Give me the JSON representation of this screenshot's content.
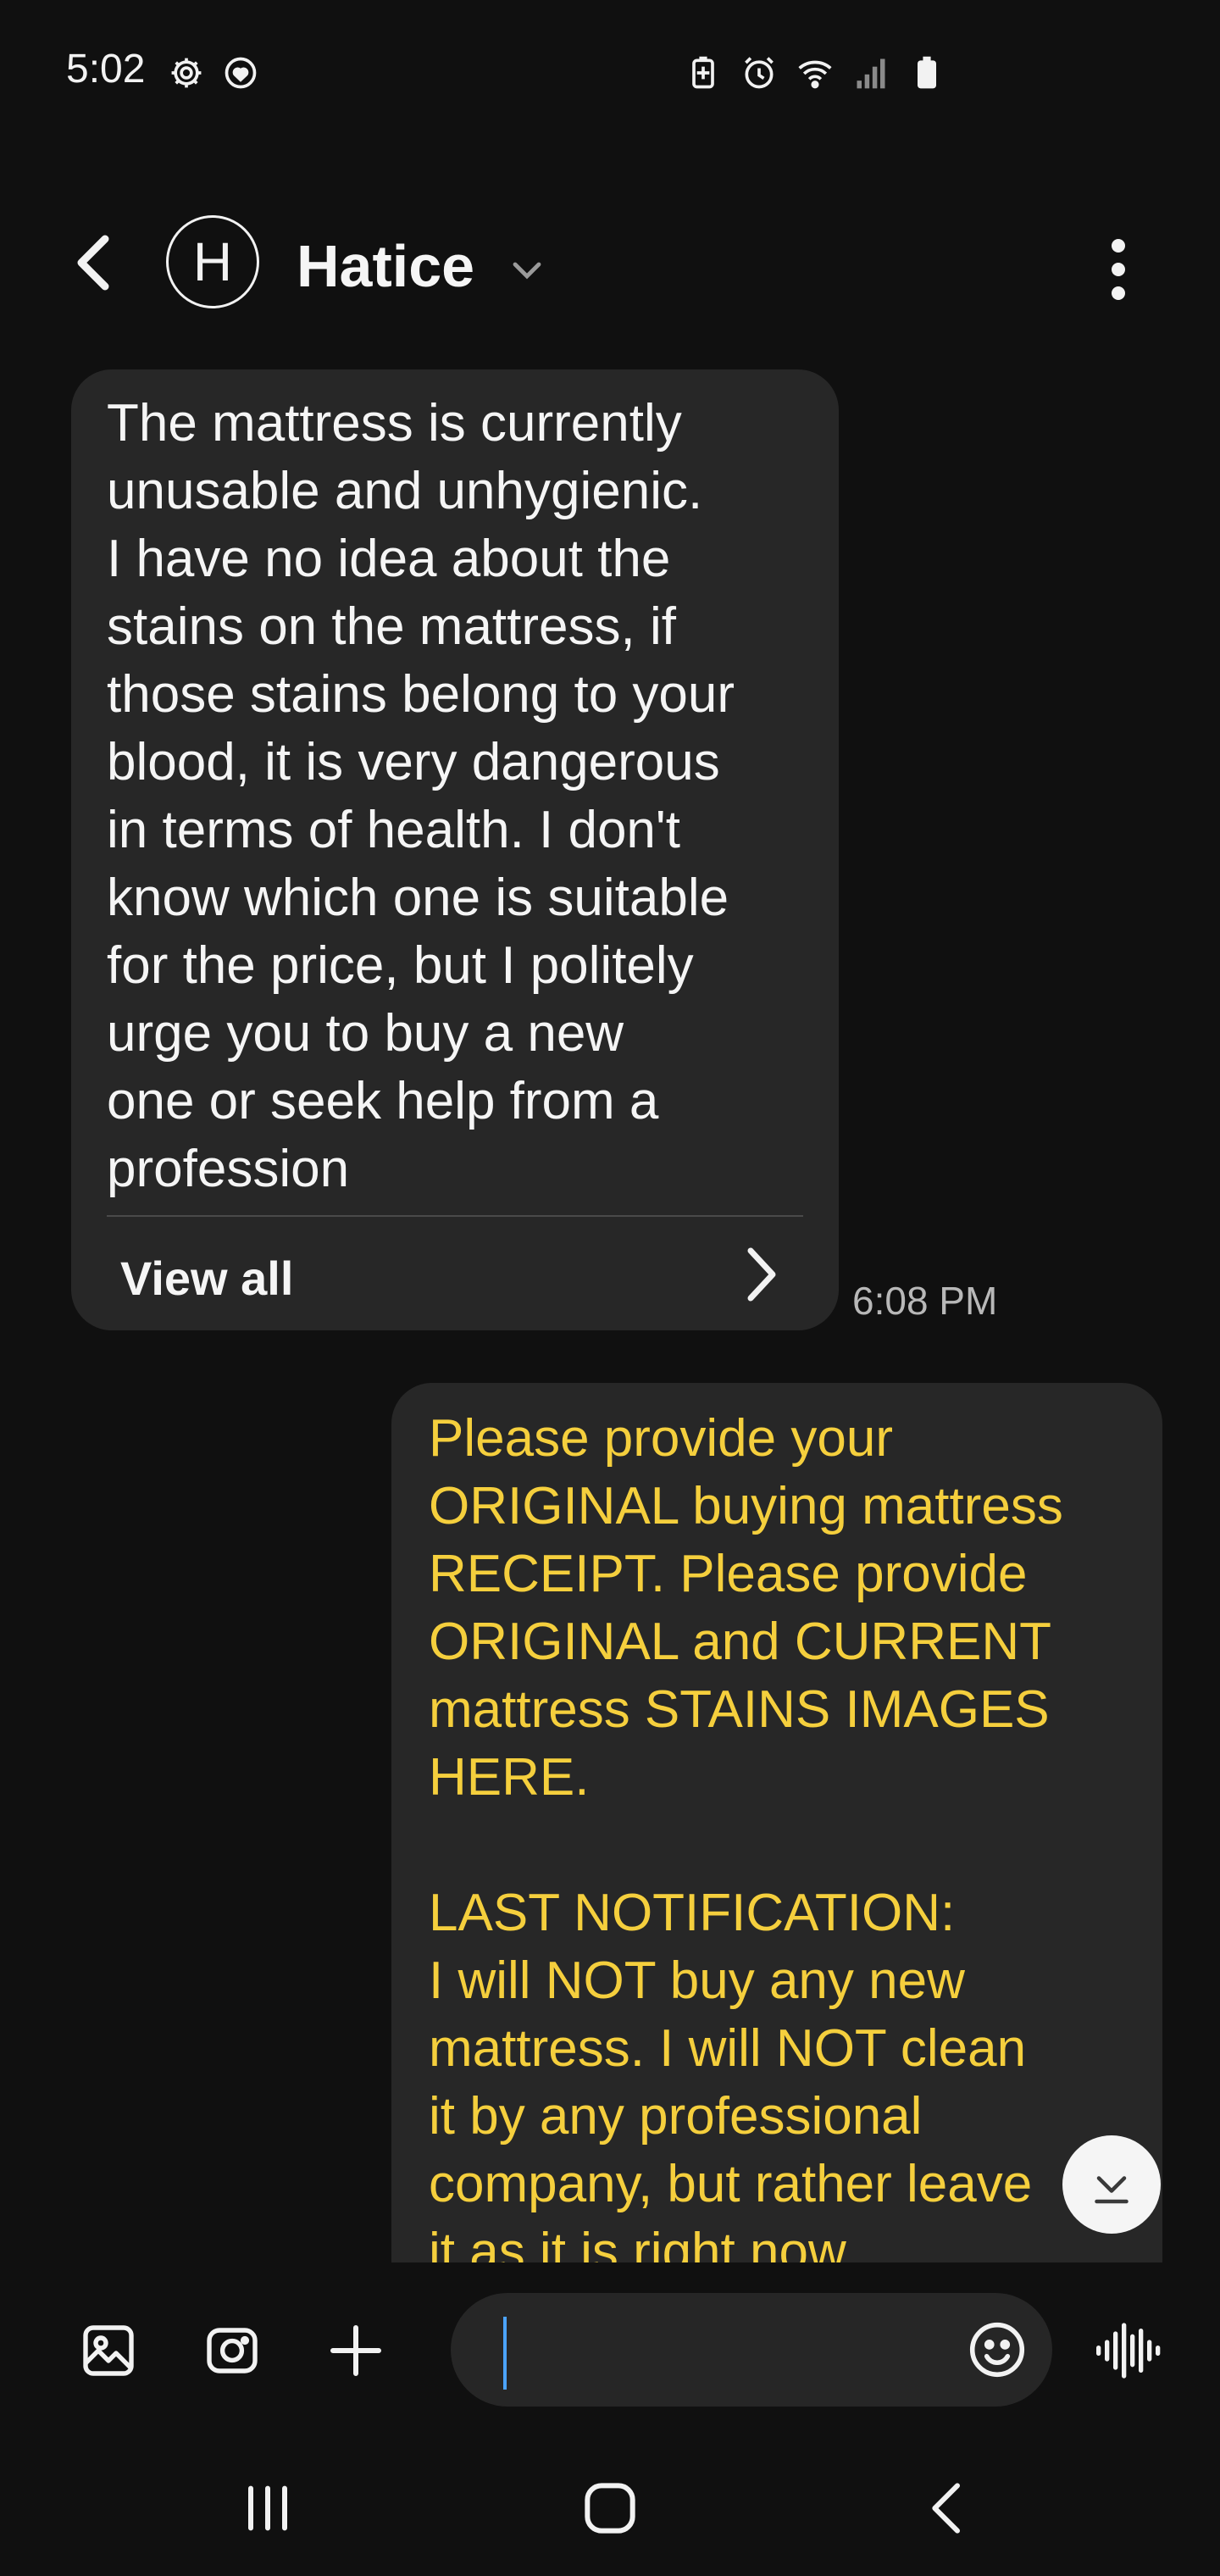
{
  "status_bar": {
    "time": "5:02",
    "left_icons": [
      "settings-icon",
      "heart-shield-icon"
    ],
    "right_icons": [
      "battery-saver-icon",
      "alarm-icon",
      "wifi-icon",
      "signal-icon",
      "battery-icon"
    ]
  },
  "header": {
    "avatar_letter": "H",
    "contact_name": "Hatice"
  },
  "messages": [
    {
      "direction": "incoming",
      "text": "The mattress is currently\nunusable and unhygienic.\nI have no idea about the\nstains on the mattress, if\nthose stains belong to your\nblood, it is very dangerous\nin terms of health. I don't\nknow which one is suitable\nfor the price, but I politely\nurge you to buy a new\none or seek help from a\nprofession",
      "view_all_label": "View all",
      "time": "6:08 PM"
    },
    {
      "direction": "outgoing",
      "text": "Please provide your\nORIGINAL buying mattress\nRECEIPT. Please provide\nORIGINAL and CURRENT\nmattress STAINS IMAGES\nHERE.\n\nLAST NOTIFICATION:\nI will NOT buy any new\nmattress. I will NOT clean\nit by any professional\ncompany, but rather leave\nit as it is right now.",
      "color": "#f5cf3d"
    }
  ],
  "composer": {
    "input_value": "",
    "icons": [
      "gallery-icon",
      "camera-icon",
      "plus-icon",
      "emoji-icon",
      "voice-icon"
    ]
  },
  "nav_bar": {
    "icons": [
      "recents-icon",
      "home-icon",
      "back-icon"
    ]
  },
  "colors": {
    "background": "#101010",
    "bubble": "#272727",
    "outgoing_text": "#f5cf3d",
    "accent_caret": "#4ba3ff"
  }
}
